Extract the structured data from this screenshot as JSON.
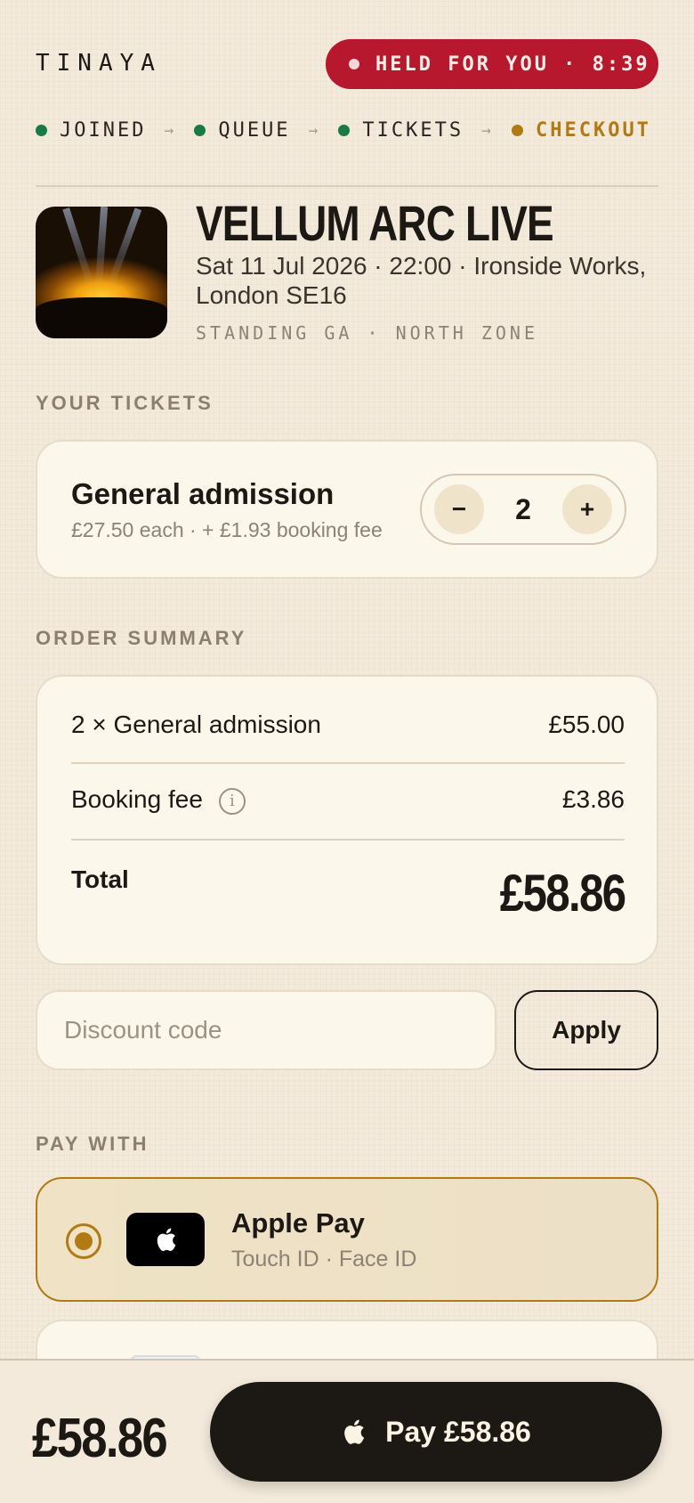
{
  "header": {
    "brand": "TINAYA",
    "hold_label": "HELD FOR YOU · 8:39"
  },
  "steps": [
    {
      "label": "JOINED",
      "status": "done"
    },
    {
      "label": "QUEUE",
      "status": "done"
    },
    {
      "label": "TICKETS",
      "status": "done"
    },
    {
      "label": "CHECKOUT",
      "status": "active"
    }
  ],
  "event": {
    "title": "VELLUM ARC LIVE",
    "meta": "Sat 11 Jul 2026 · 22:00 · Ironside Works, London SE16",
    "zone": "STANDING GA · NORTH ZONE"
  },
  "tickets": {
    "section_label": "YOUR TICKETS",
    "name": "General admission",
    "price_line": "£27.50 each · + £1.93 booking fee",
    "quantity": "2",
    "minus": "−",
    "plus": "+"
  },
  "summary": {
    "section_label": "ORDER SUMMARY",
    "line_item_label": "2 × General admission",
    "line_item_value": "£55.00",
    "fee_label": "Booking fee",
    "fee_info": "i",
    "fee_value": "£3.86",
    "total_label": "Total",
    "total_value": "£58.86"
  },
  "discount": {
    "placeholder": "Discount code",
    "apply_label": "Apply"
  },
  "payment": {
    "section_label": "PAY WITH",
    "selected": {
      "name": "Apple Pay",
      "sub": "Touch ID · Face ID"
    }
  },
  "footer": {
    "total": "£58.86",
    "pay_label": "Pay £58.86"
  },
  "colors": {
    "accent": "#b07a14",
    "hold_red": "#b8182e",
    "done_green": "#1a7a47",
    "ink": "#1c1814"
  }
}
